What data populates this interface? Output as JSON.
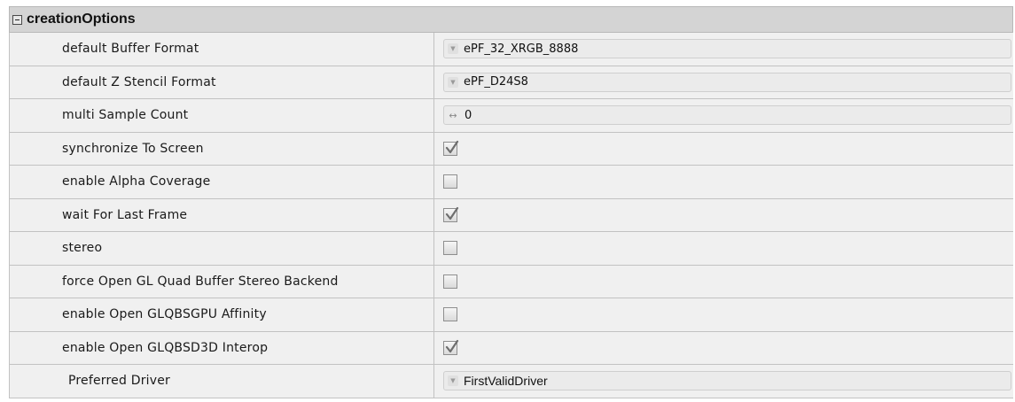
{
  "section": {
    "title": "creationOptions",
    "collapse_icon": "minus-box-icon"
  },
  "rows": [
    {
      "label": "default Buffer Format",
      "type": "dropdown",
      "value": "ePF_32_XRGB_8888"
    },
    {
      "label": "default Z Stencil Format",
      "type": "dropdown",
      "value": "ePF_D24S8"
    },
    {
      "label": "multi Sample Count",
      "type": "spinner",
      "value": "0"
    },
    {
      "label": "synchronize To Screen",
      "type": "checkbox",
      "checked": true
    },
    {
      "label": "enable Alpha Coverage",
      "type": "checkbox",
      "checked": false
    },
    {
      "label": "wait For Last Frame",
      "type": "checkbox",
      "checked": true
    },
    {
      "label": "stereo",
      "type": "checkbox",
      "checked": false
    },
    {
      "label": "force Open GL Quad Buffer Stereo Backend",
      "type": "checkbox",
      "checked": false
    },
    {
      "label": "enable Open GLQBSGPU Affinity",
      "type": "checkbox",
      "checked": false
    },
    {
      "label": "enable Open GLQBSD3D Interop",
      "type": "checkbox",
      "checked": true
    },
    {
      "label": "Preferred Driver",
      "type": "dropdown",
      "value": "FirstValidDriver"
    }
  ],
  "icons": {
    "dropdown": "dropdown-arrow-icon",
    "spinner": "horizontal-resize-icon",
    "check": "checkmark-icon"
  },
  "colors": {
    "header_bg": "#d4d4d4",
    "row_bg": "#f0f0f0",
    "field_bg": "#ebebeb",
    "border": "#c2c2c2"
  }
}
